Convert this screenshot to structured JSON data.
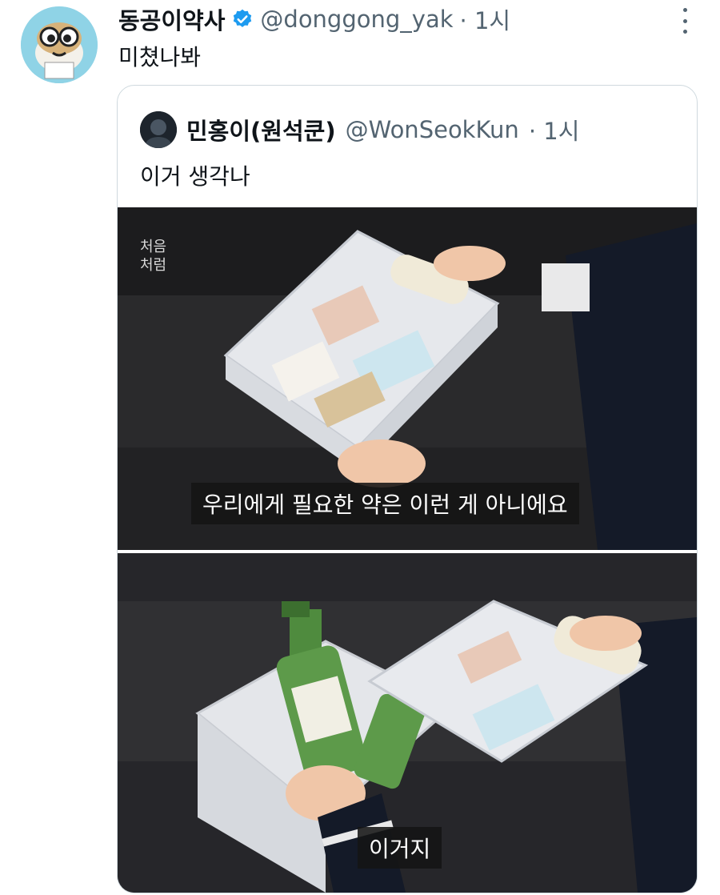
{
  "tweet": {
    "display_name": "동공이약사",
    "handle": "@donggong_yak",
    "time": "· 1시",
    "text": "미쳤나봐"
  },
  "quote": {
    "display_name": "민홍이(원석쿤)",
    "handle": "@WonSeokKun",
    "time": "· 1시",
    "text": "이거 생각나",
    "media": [
      {
        "caption": "우리에게 필요한 약은 이런 게 아니에요"
      },
      {
        "caption": "이거지"
      }
    ]
  },
  "icons": {
    "verified": "verified-badge-icon",
    "more": "more-options-icon"
  },
  "colors": {
    "verified": "#1d9bf0",
    "secondary_text": "#536471",
    "border": "#cfd9de",
    "avatar_bg": "#8fd3e6"
  }
}
